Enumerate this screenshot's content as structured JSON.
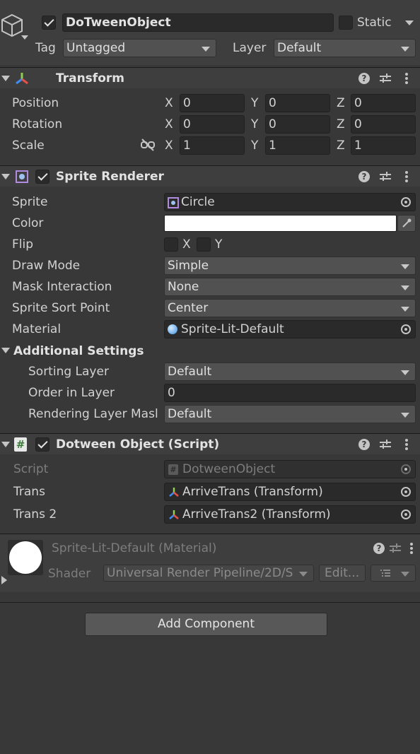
{
  "object": {
    "name": "DoTweenObject",
    "static_label": "Static",
    "tag_label": "Tag",
    "tag_value": "Untagged",
    "layer_label": "Layer",
    "layer_value": "Default"
  },
  "transform": {
    "title": "Transform",
    "rows": [
      {
        "label": "Position",
        "x": "0",
        "y": "0",
        "z": "0"
      },
      {
        "label": "Rotation",
        "x": "0",
        "y": "0",
        "z": "0"
      },
      {
        "label": "Scale",
        "x": "1",
        "y": "1",
        "z": "1"
      }
    ],
    "axis_x": "X",
    "axis_y": "Y",
    "axis_z": "Z"
  },
  "sprite_renderer": {
    "title": "Sprite Renderer",
    "sprite_label": "Sprite",
    "sprite_value": "Circle",
    "color_label": "Color",
    "color_value": "#ffffff",
    "flip_label": "Flip",
    "flip_x": "X",
    "flip_y": "Y",
    "draw_mode_label": "Draw Mode",
    "draw_mode_value": "Simple",
    "mask_label": "Mask Interaction",
    "mask_value": "None",
    "sort_point_label": "Sprite Sort Point",
    "sort_point_value": "Center",
    "material_label": "Material",
    "material_value": "Sprite-Lit-Default",
    "additional_label": "Additional Settings",
    "sorting_layer_label": "Sorting Layer",
    "sorting_layer_value": "Default",
    "order_label": "Order in Layer",
    "order_value": "0",
    "rendering_mask_label": "Rendering Layer Masl",
    "rendering_mask_value": "Default"
  },
  "dotween_script": {
    "title": "Dotween Object (Script)",
    "script_label": "Script",
    "script_value": "DotweenObject",
    "trans_label": "Trans",
    "trans_value": "ArriveTrans (Transform)",
    "trans2_label": "Trans 2",
    "trans2_value": "ArriveTrans2 (Transform)"
  },
  "material": {
    "title": "Sprite-Lit-Default (Material)",
    "shader_label": "Shader",
    "shader_value": "Universal Render Pipeline/2D/S",
    "edit_label": "Edit..."
  },
  "add_component_label": "Add Component",
  "colors": {
    "background": "#383838",
    "header": "#3e3e3e",
    "field": "#2a2a2a",
    "dropdown": "#515151"
  }
}
